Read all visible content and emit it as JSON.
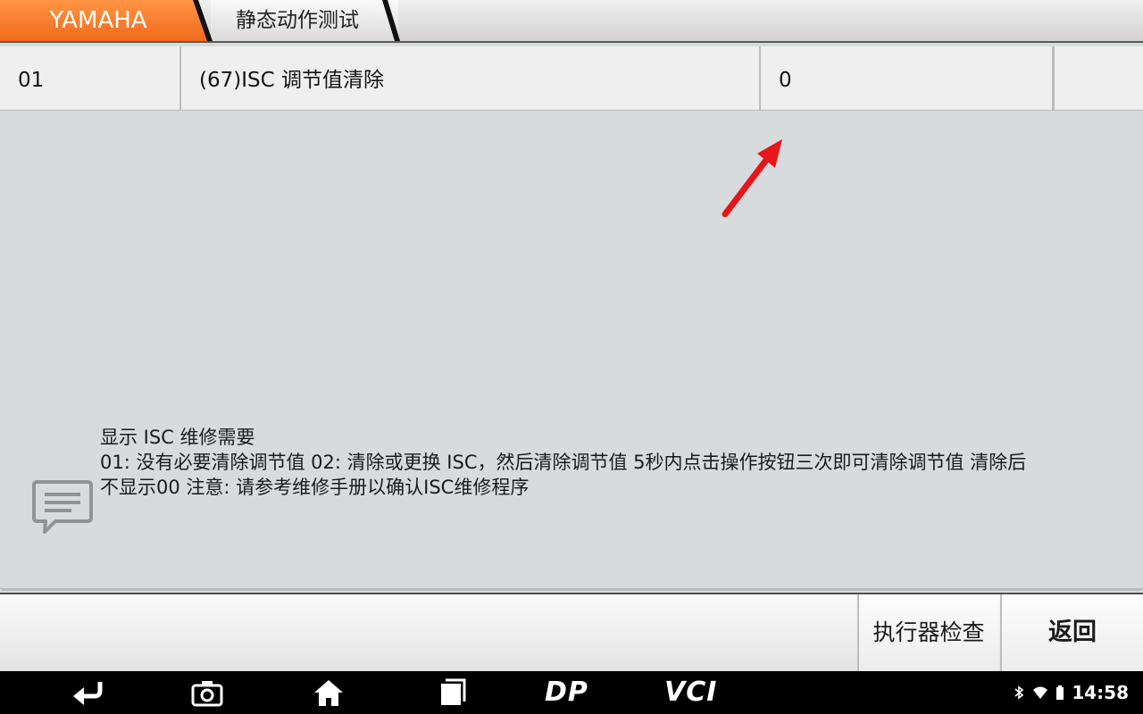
{
  "breadcrumb": {
    "brand": "YAMAHA",
    "page": "静态动作测试",
    "brand_color": "#f37a26"
  },
  "table": {
    "row": {
      "id": "01",
      "name": "(67)ISC 调节值清除",
      "value": "0",
      "extra": ""
    }
  },
  "info": {
    "icon": "message-icon",
    "line1": "显示 ISC 维修需要",
    "line2": "01: 没有必要清除调节值 02: 清除或更换 ISC，然后清除调节值 5秒内点击操作按钮三次即可清除调节值 清除后",
    "line3": "不显示00 注意: 请参考维修手册以确认ISC维修程序"
  },
  "annotation": {
    "arrow_color": "#e8151b"
  },
  "actions": {
    "actuator_label": "执行器检查",
    "back_label": "返回"
  },
  "navbar": {
    "icons": [
      "back-icon",
      "camera-icon",
      "home-icon",
      "recent-apps-icon",
      "dp-icon",
      "vci-icon"
    ],
    "dp_label": "DP",
    "vci_label": "VCI",
    "status_icons": [
      "bluetooth-icon",
      "wifi-icon",
      "battery-icon"
    ],
    "time": "14:58"
  }
}
